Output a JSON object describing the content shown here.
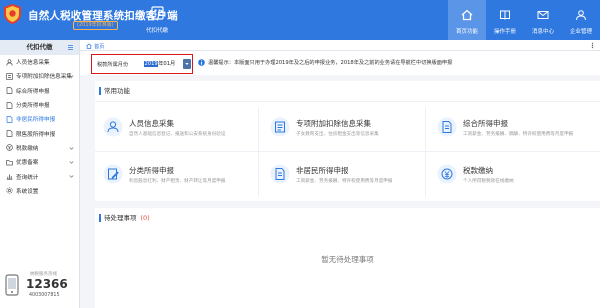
{
  "header": {
    "app_title": "自然人税收管理系统扣缴客户端",
    "version_badge": "(2019年标准版)",
    "mode_label": "代扣代缴",
    "nav": [
      {
        "label": "首页功能",
        "icon": "home-icon",
        "active": true
      },
      {
        "label": "操作手册",
        "icon": "book-icon",
        "active": false
      },
      {
        "label": "消息中心",
        "icon": "envelope-icon",
        "active": false
      },
      {
        "label": "企业管理",
        "icon": "user-icon",
        "active": false
      }
    ]
  },
  "sidebar": {
    "title": "代扣代缴",
    "items": [
      {
        "label": "人员信息采集",
        "icon": "person-icon",
        "active": false,
        "has_caret": false
      },
      {
        "label": "专项附加扣除信息采集",
        "icon": "list-icon",
        "active": false,
        "has_caret": true
      },
      {
        "label": "综合所得申报",
        "icon": "doc-icon",
        "active": false,
        "has_caret": false
      },
      {
        "label": "分类所得申报",
        "icon": "doc-icon",
        "active": false,
        "has_caret": false
      },
      {
        "label": "非居民所得申报",
        "icon": "doc-icon",
        "active": true,
        "has_caret": false
      },
      {
        "label": "限售股所得申报",
        "icon": "doc-icon",
        "active": false,
        "has_caret": false
      },
      {
        "label": "税款缴纳",
        "icon": "coin-icon",
        "active": false,
        "has_caret": true
      },
      {
        "label": "优惠备案",
        "icon": "folder-icon",
        "active": false,
        "has_caret": true
      },
      {
        "label": "查询统计",
        "icon": "chart-icon",
        "active": false,
        "has_caret": true
      },
      {
        "label": "系统设置",
        "icon": "gear-icon",
        "active": false,
        "has_caret": false
      }
    ],
    "hotline": {
      "caption": "纳税服务热线",
      "number_big": "12366",
      "number_small": "4003007815"
    }
  },
  "tabs": {
    "home_label": "首页"
  },
  "filter": {
    "period_label": "税款所属月份",
    "period_year": "2019",
    "period_rest": "年01月",
    "notice_text": "温馨提示：本版面只用于办理2019年及之后的申报业务，2018年及之前的业务请在导航栏中切换版面申报"
  },
  "common": {
    "title": "常用功能",
    "cards": [
      {
        "title": "人员信息采集",
        "desc": "自然人基础信息登记、报送和公安系统身份验证",
        "icon": "person-card-icon"
      },
      {
        "title": "专项附加扣除信息采集",
        "desc": "子女教育支出、住房租金支出等信息采集",
        "icon": "list-card-icon"
      },
      {
        "title": "综合所得申报",
        "desc": "工资薪金、劳务报酬、稿酬、特许权使用费等月度申报",
        "icon": "doc-card-icon"
      },
      {
        "title": "分类所得申报",
        "desc": "利息股息红利、财产租赁、财产转让等月度申报",
        "icon": "edit-card-icon"
      },
      {
        "title": "非居民所得申报",
        "desc": "工资薪金、劳务报酬、特许权使用费等月度申报",
        "icon": "doc-card-icon"
      },
      {
        "title": "税款缴纳",
        "desc": "个人所得税税款在线缴纳",
        "icon": "money-card-icon"
      }
    ]
  },
  "todo": {
    "title": "待处理事项",
    "count": "(0)",
    "empty_text": "暂无待处理事项"
  },
  "colors": {
    "brand_blue": "#2f78e0",
    "highlight_red": "#d41a1a",
    "badge_orange": "#ffb24d"
  }
}
